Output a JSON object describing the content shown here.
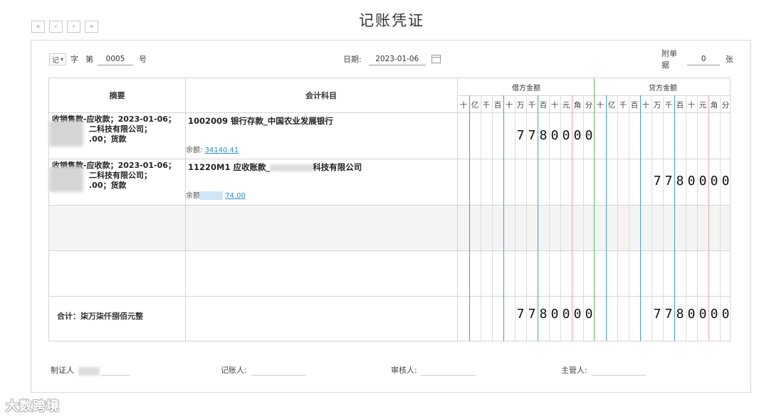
{
  "title": "记账凭证",
  "nav": [
    "«",
    "‹",
    "›",
    "»"
  ],
  "header": {
    "voucher_type": "记",
    "zi_label": "字",
    "di_label": "第",
    "voucher_no": "0005",
    "hao_label": "号",
    "date_label": "日期:",
    "date_value": "2023-01-06",
    "attach_label": "附单据",
    "attach_count": "0",
    "zhang_label": "张"
  },
  "table": {
    "col_summary": "摘要",
    "col_account": "会计科目",
    "col_debit": "借方金额",
    "col_credit": "贷方金额",
    "digits": [
      "十",
      "亿",
      "千",
      "百",
      "十",
      "万",
      "千",
      "百",
      "十",
      "元",
      "角",
      "分"
    ],
    "rows": [
      {
        "summary_1": "收销售款-应收款；2023-01-06；",
        "summary_2": "二科技有限公司；",
        "summary_3": ".00；货款",
        "account": "1002009 银行存款_中国农业发展银行",
        "balance_label": "余额:",
        "balance_value": "34140.41",
        "debit_digits": [
          "",
          "",
          "",
          "",
          "",
          "7",
          "7",
          "8",
          "0",
          "0",
          "0",
          "0"
        ],
        "credit_digits": [
          "",
          "",
          "",
          "",
          "",
          "",
          "",
          "",
          "",
          "",
          "",
          ""
        ]
      },
      {
        "summary_1": "收销售款-应收款；2023-01-06；",
        "summary_2": "二科技有限公司；",
        "summary_3": ".00；货款",
        "account": "11220M1 应收账款_",
        "account_tail": "科技有限公司",
        "balance_label": "余额",
        "balance_value": "74.00",
        "debit_digits": [
          "",
          "",
          "",
          "",
          "",
          "",
          "",
          "",
          "",
          "",
          "",
          ""
        ],
        "credit_digits": [
          "",
          "",
          "",
          "",
          "",
          "7",
          "7",
          "8",
          "0",
          "0",
          "0",
          "0"
        ]
      }
    ],
    "total_label": "合计：柒万柒仟捌佰元整",
    "total_debit_digits": [
      "",
      "",
      "",
      "",
      "",
      "7",
      "7",
      "8",
      "0",
      "0",
      "0",
      "0"
    ],
    "total_credit_digits": [
      "",
      "",
      "",
      "",
      "",
      "7",
      "7",
      "8",
      "0",
      "0",
      "0",
      "0"
    ]
  },
  "signatures": {
    "maker": "制证人",
    "bookkeeper": "记账人:",
    "auditor": "审核人:",
    "supervisor": "主管人:"
  },
  "watermark": "大数跨境",
  "colors": {
    "blue_line": "#3aa0e0",
    "red_line": "#f0a0a0",
    "green_line": "#5cbf5c",
    "link": "#2a8bd5"
  }
}
